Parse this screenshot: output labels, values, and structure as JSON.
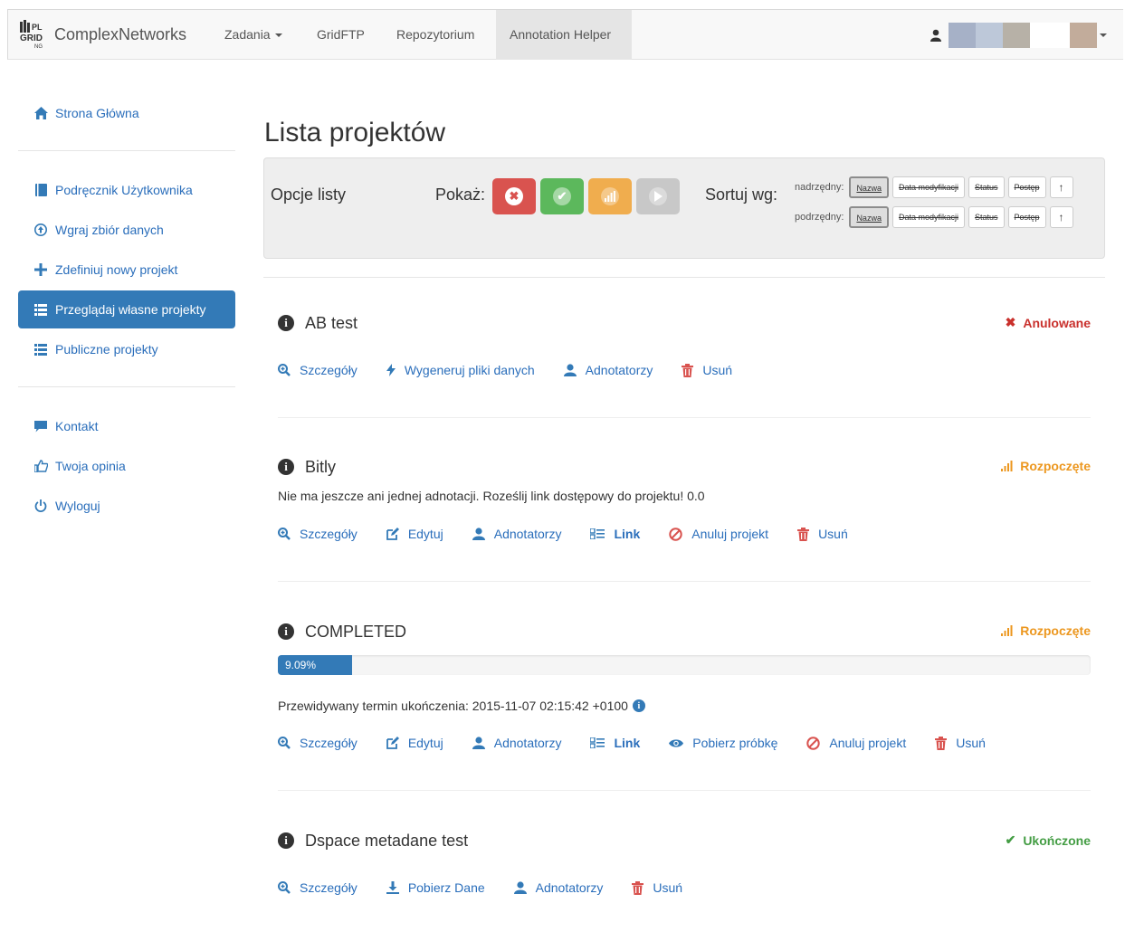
{
  "navbar": {
    "brand": "ComplexNetworks",
    "logo_text": "PL GRID NG",
    "items": [
      {
        "label": "Zadania",
        "dropdown": true
      },
      {
        "label": "GridFTP"
      },
      {
        "label": "Repozytorium"
      },
      {
        "label": "Annotation Helper",
        "active": true
      }
    ],
    "user_icon": "user-icon"
  },
  "sidebar": {
    "group1": [
      {
        "label": "Strona Główna",
        "icon": "home-icon"
      }
    ],
    "group2": [
      {
        "label": "Podręcznik Użytkownika",
        "icon": "book-icon"
      },
      {
        "label": "Wgraj zbiór danych",
        "icon": "upload-icon"
      },
      {
        "label": "Zdefiniuj nowy projekt",
        "icon": "plus-icon"
      },
      {
        "label": "Przeglądaj własne projekty",
        "icon": "list-icon",
        "active": true
      },
      {
        "label": "Publiczne projekty",
        "icon": "list-icon"
      }
    ],
    "group3": [
      {
        "label": "Kontakt",
        "icon": "comment-icon"
      },
      {
        "label": "Twoja opinia",
        "icon": "thumbs-up-icon"
      },
      {
        "label": "Wyloguj",
        "icon": "power-icon"
      }
    ]
  },
  "main": {
    "title": "Lista projektów",
    "options": {
      "label": "Opcje listy",
      "show_label": "Pokaż:",
      "filters": [
        {
          "name": "cancelled",
          "color": "#d9534f",
          "glyph": "✖"
        },
        {
          "name": "completed",
          "color": "#5cb85c",
          "glyph": "✔"
        },
        {
          "name": "started",
          "color": "#f0ad4e",
          "glyph": "signal"
        },
        {
          "name": "not-started",
          "color": "#c8c8c8",
          "glyph": "play"
        }
      ],
      "sort_label": "Sortuj wg:",
      "primary_label": "nadrzędny:",
      "secondary_label": "podrzędny:",
      "sort_options": [
        "Nazwa",
        "Data modyfikacji",
        "Status",
        "Postęp"
      ],
      "arrow": "↑"
    }
  },
  "projects": [
    {
      "name": "AB test",
      "status": "Anulowane",
      "actions": [
        "Szczegóły",
        "Wygeneruj pliki danych",
        "Adnotatorzy",
        "Usuń"
      ]
    },
    {
      "name": "Bitly",
      "status": "Rozpoczęte",
      "note": "Nie ma jeszcze ani jednej adnotacji. Roześlij link dostępowy do projektu! 0.0",
      "actions": [
        "Szczegóły",
        "Edytuj",
        "Adnotatorzy",
        "Link",
        "Anuluj projekt",
        "Usuń"
      ]
    },
    {
      "name": "COMPLETED",
      "status": "Rozpoczęte",
      "progress": 9.09,
      "progress_label": "9.09%",
      "note": "Przewidywany termin ukończenia: 2015-11-07 02:15:42 +0100",
      "actions": [
        "Szczegóły",
        "Edytuj",
        "Adnotatorzy",
        "Link",
        "Pobierz próbkę",
        "Anuluj projekt",
        "Usuń"
      ]
    },
    {
      "name": "Dspace metadane test",
      "status": "Ukończone",
      "actions": [
        "Szczegóły",
        "Pobierz Dane",
        "Adnotatorzy",
        "Usuń"
      ]
    }
  ]
}
